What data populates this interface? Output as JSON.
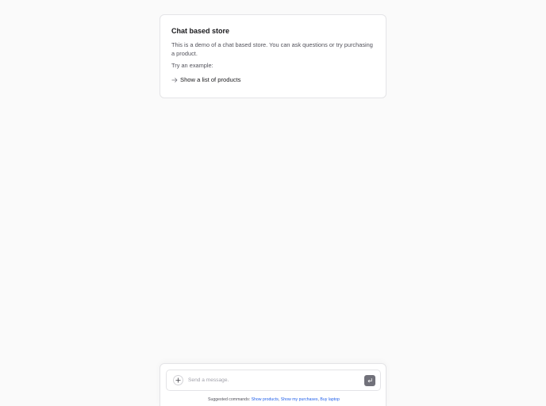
{
  "intro": {
    "title": "Chat based store",
    "description": "This is a demo of a chat based store. You can ask questions or try purchasing a product.",
    "try_label": "Try an example:",
    "example": "Show a list of products"
  },
  "composer": {
    "placeholder": "Send a message.",
    "value": ""
  },
  "suggestions": {
    "label": "Suggested commands:",
    "commands": [
      "Show products",
      "Show my purchases",
      "Buy laptop"
    ],
    "separator": ","
  },
  "colors": {
    "background": "#fafafa",
    "card": "#ffffff",
    "border": "#e4e4e7",
    "link": "#2563eb",
    "send_button": "#71717a"
  },
  "icons": {
    "example_arrow": "arrow-right-icon",
    "attach": "plus-icon",
    "send": "enter-icon"
  }
}
